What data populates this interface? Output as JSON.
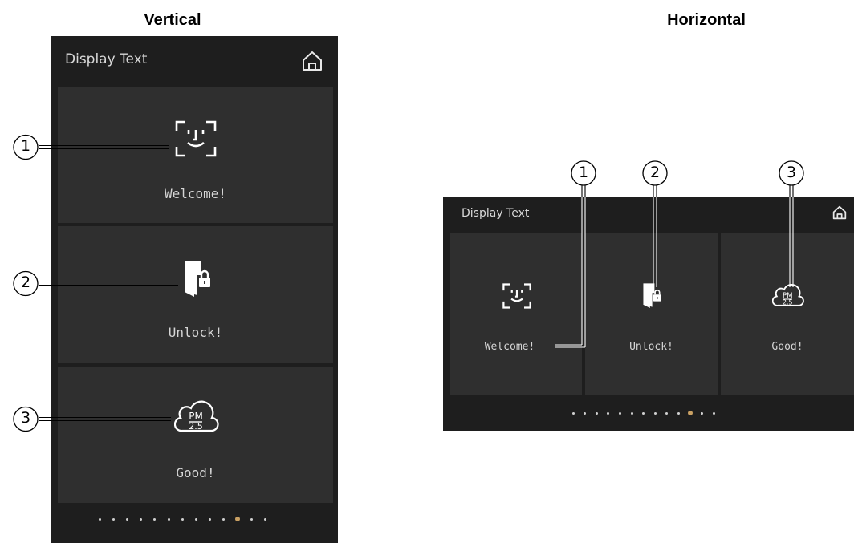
{
  "headings": {
    "vertical": "Vertical",
    "horizontal": "Horizontal"
  },
  "panel": {
    "title": "Display Text"
  },
  "tiles": [
    {
      "label": "Welcome!",
      "icon": "face-recognition-icon"
    },
    {
      "label": "Unlock!",
      "icon": "door-lock-icon"
    },
    {
      "label": "Good!",
      "icon": "pm25-cloud-icon"
    }
  ],
  "callouts": [
    "1",
    "2",
    "3"
  ],
  "pagination": {
    "total": 13,
    "active_index": 10,
    "active_color": "#c9a063"
  },
  "colors": {
    "panel_bg": "#1e1e1e",
    "tile_bg": "#2f2f2f",
    "text": "#d6d6d6",
    "page_bg": "#ffffff"
  }
}
